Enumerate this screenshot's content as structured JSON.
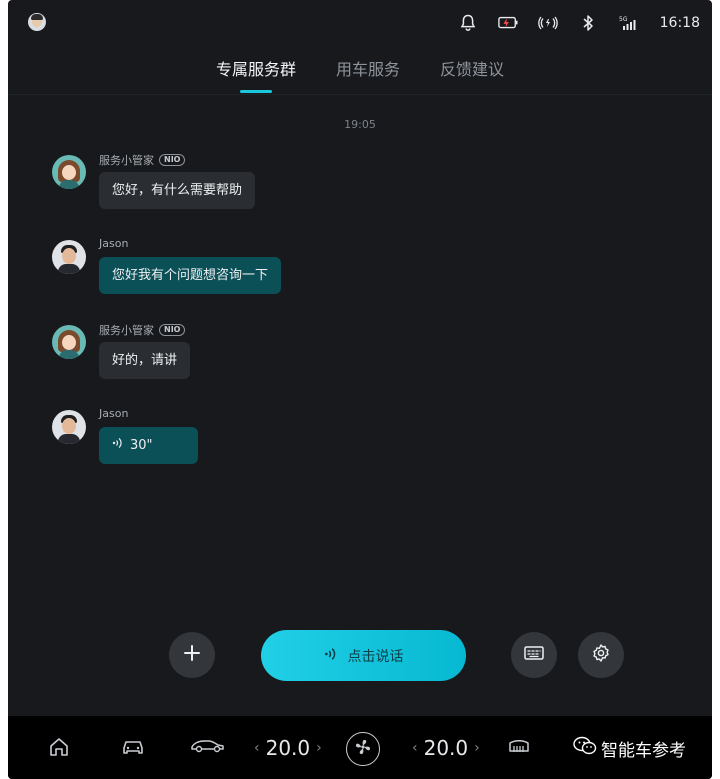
{
  "status_bar": {
    "time": "16:18",
    "signal_label": "5G",
    "icons": [
      "user-avatar-icon",
      "bell-icon",
      "charging-icon",
      "wireless-icon",
      "bluetooth-icon",
      "5g-signal-icon"
    ]
  },
  "tabs": [
    {
      "label": "专属服务群",
      "active": true
    },
    {
      "label": "用车服务",
      "active": false
    },
    {
      "label": "反馈建议",
      "active": false
    }
  ],
  "chat": {
    "timestamp": "19:05",
    "messages": [
      {
        "sender": "服务小管家",
        "badge": "NIO",
        "role": "agent",
        "text": "您好，有什么需要帮助"
      },
      {
        "sender": "Jason",
        "role": "user",
        "text": "您好我有个问题想咨询一下"
      },
      {
        "sender": "服务小管家",
        "badge": "NIO",
        "role": "agent",
        "text": "好的，请讲"
      },
      {
        "sender": "Jason",
        "role": "user",
        "voice_duration": "30\""
      }
    ]
  },
  "actions": {
    "talk_label": "点击说话",
    "icons": [
      "plus-icon",
      "voice-icon",
      "keyboard-icon",
      "settings-icon"
    ]
  },
  "dock": {
    "left_temp": "20.0",
    "right_temp": "20.0",
    "watermark": "智能车参考",
    "icons": [
      "home-icon",
      "car-icon",
      "car-top-icon",
      "fan-icon",
      "rear-defrost-icon"
    ]
  },
  "colors": {
    "accent": "#19c8dc",
    "background": "#17191d",
    "agent_bubble": "#2a2d32",
    "user_bubble": "#0b5057"
  }
}
